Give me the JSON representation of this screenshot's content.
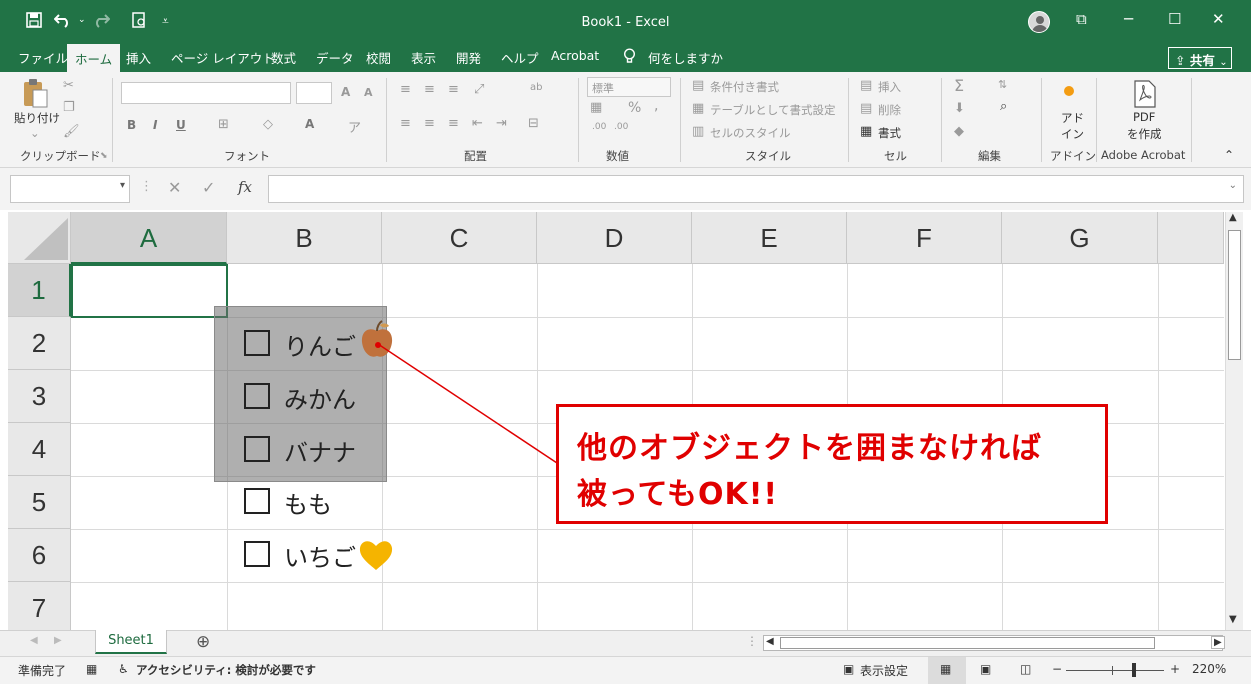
{
  "title_bar": {
    "title": "Book1  -  Excel",
    "save_icon": "save-icon",
    "undo_icon": "undo-icon",
    "redo_icon": "redo-icon",
    "preview_icon": "print-preview-icon",
    "minimize": "─",
    "maximize": "☐",
    "close": "✕",
    "ribbon_display": "⧉"
  },
  "tabs": [
    "ファイル",
    "ホーム",
    "挿入",
    "ページ レイアウト",
    "数式",
    "データ",
    "校閲",
    "表示",
    "開発",
    "ヘルプ",
    "Acrobat",
    "何をしますか"
  ],
  "active_tab": "ホーム",
  "share_label": "共有",
  "ribbon": {
    "clipboard": {
      "paste": "貼り付け",
      "group": "クリップボード"
    },
    "font": {
      "group": "フォント",
      "bold": "B",
      "italic": "I",
      "underline": "U",
      "grow": "A",
      "shrink": "A"
    },
    "alignment": {
      "group": "配置"
    },
    "number": {
      "group": "数値",
      "format": "標準",
      "percent": "%",
      "comma": ","
    },
    "styles": {
      "group": "スタイル",
      "conditional": "条件付き書式",
      "table": "テーブルとして書式設定",
      "cell_styles": "セルのスタイル"
    },
    "cells": {
      "group": "セル",
      "insert": "挿入",
      "delete": "削除",
      "format": "書式"
    },
    "editing": {
      "group": "編集"
    },
    "addins": {
      "group": "アドイン",
      "label_line1": "アド",
      "label_line2": "イン"
    },
    "acrobat": {
      "group": "Adobe Acrobat",
      "label_line1": "PDF",
      "label_line2": "を作成"
    }
  },
  "formula_bar": {
    "fx": "fx",
    "cancel": "✕",
    "enter": "✓",
    "namebox": "",
    "value": ""
  },
  "columns": [
    "A",
    "B",
    "C",
    "D",
    "E",
    "F",
    "G"
  ],
  "selected_column": "A",
  "rows": [
    "1",
    "2",
    "3",
    "4",
    "5",
    "6",
    "7"
  ],
  "selected_row": "1",
  "checkboxes": [
    {
      "label": "りんご",
      "checked": false,
      "emoji": "🍎"
    },
    {
      "label": "みかん",
      "checked": false
    },
    {
      "label": "バナナ",
      "checked": false
    },
    {
      "label": "もも",
      "checked": false
    },
    {
      "label": "いちご",
      "checked": false,
      "emoji": "💛"
    }
  ],
  "callout": {
    "line1": "他のオブジェクトを囲まなければ",
    "line2": "被ってもOK!!",
    "color": "#e00000"
  },
  "sheets": [
    "Sheet1"
  ],
  "add_sheet": "⊕",
  "status_bar": {
    "ready": "準備完了",
    "accessibility": "アクセシビリティ: 検討が必要です",
    "display_settings": "表示設定",
    "zoom": "220%",
    "zoom_minus": "−",
    "zoom_plus": "+"
  },
  "colors": {
    "excel_green": "#217346",
    "ribbon_bg": "#f3f3f3",
    "callout_red": "#e00000"
  }
}
